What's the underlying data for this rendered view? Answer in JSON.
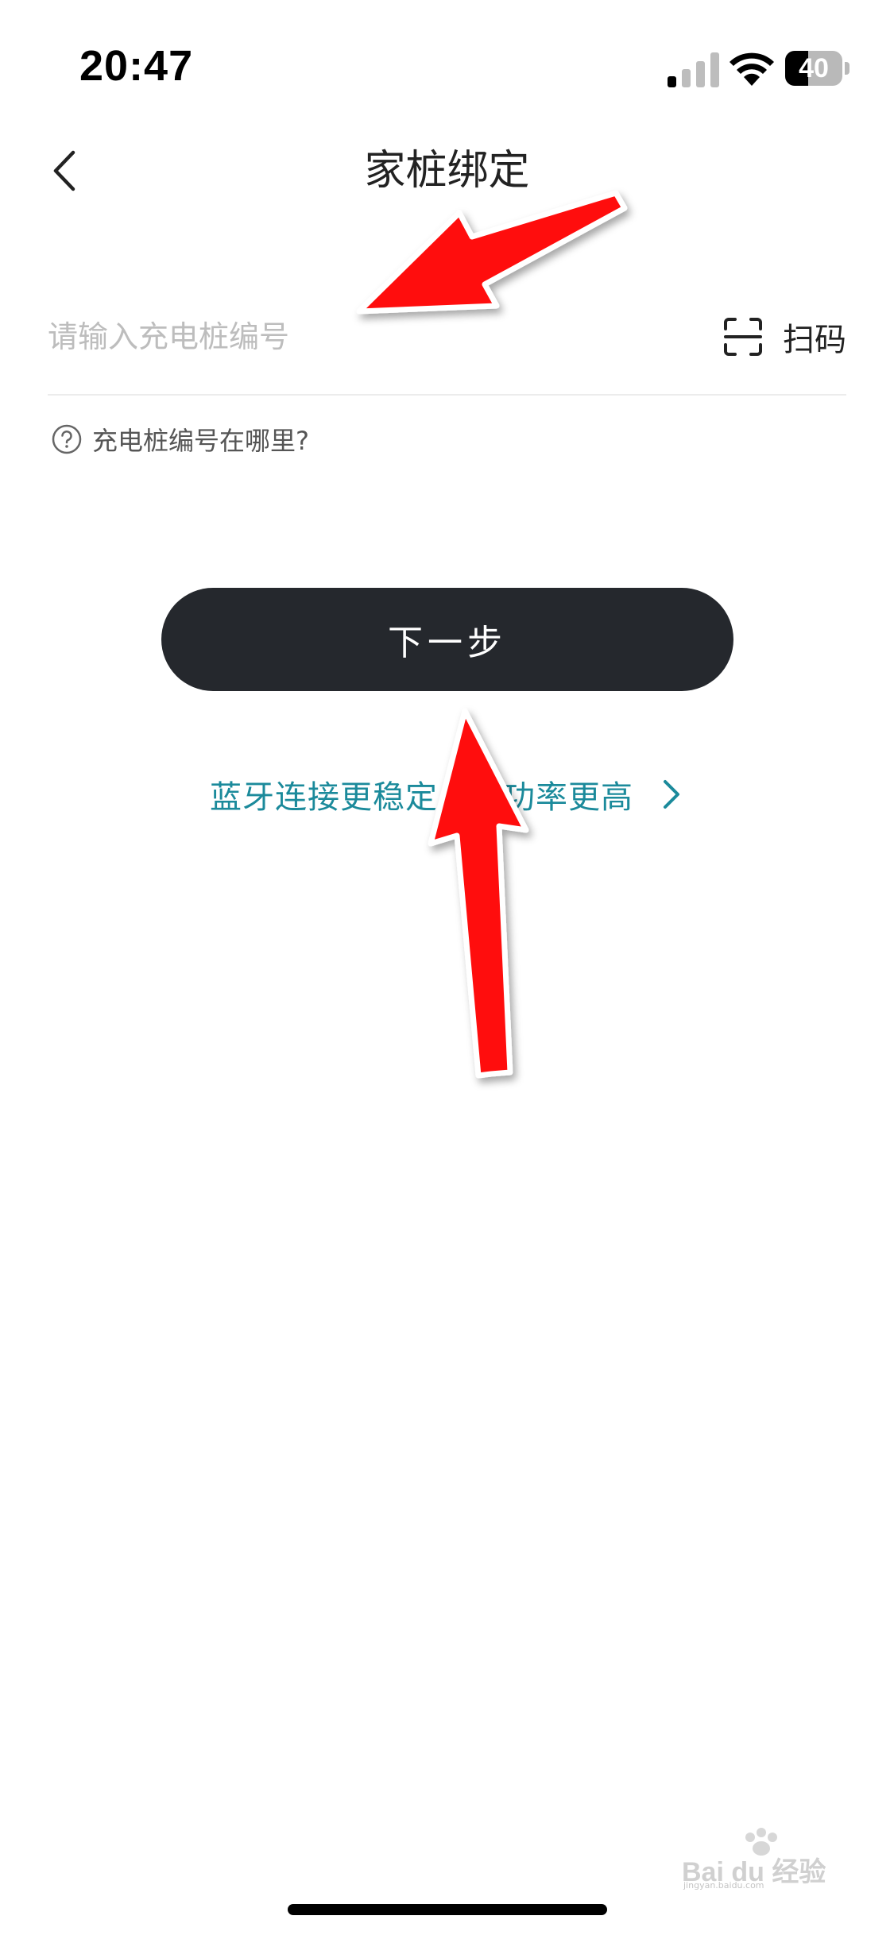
{
  "status_bar": {
    "time": "20:47",
    "battery_level": "40",
    "battery_fraction": 0.4
  },
  "nav": {
    "title": "家桩绑定",
    "back_icon": "chevron-left-icon"
  },
  "input": {
    "value": "",
    "placeholder": "请输入充电桩编号",
    "scan_label": "扫码",
    "scan_icon": "scan-frame-icon"
  },
  "help": {
    "label": "充电桩编号在哪里?",
    "icon": "question-circle-icon"
  },
  "next_button": {
    "label": "下一步"
  },
  "bluetooth_link": {
    "label": "蓝牙连接更稳定，成功率更高",
    "icon": "chevron-right-icon"
  },
  "watermark": {
    "text": "Bai du 经验",
    "sub": "jingyan.baidu.com"
  },
  "colors": {
    "button_bg": "#25282d",
    "link": "#1b8a9b",
    "annotation": "#ff0000"
  }
}
